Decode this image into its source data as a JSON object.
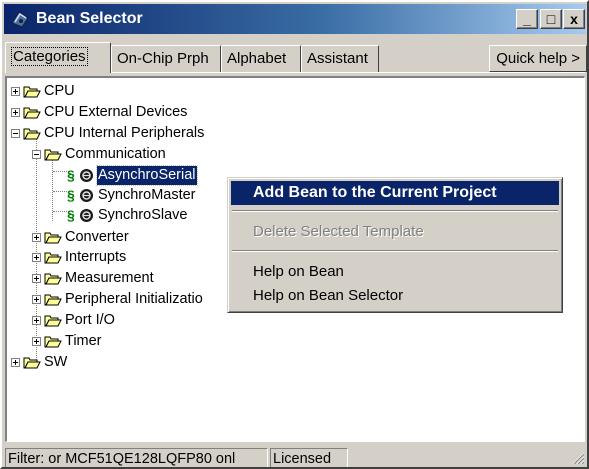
{
  "window": {
    "title": "Bean Selector",
    "buttons": {
      "minimize": "_",
      "maximize": "□",
      "close": "x"
    }
  },
  "tabs": [
    {
      "label": "Categories",
      "active": true
    },
    {
      "label": "On-Chip Prph",
      "active": false
    },
    {
      "label": "Alphabet",
      "active": false
    },
    {
      "label": "Assistant",
      "active": false
    }
  ],
  "quick_help": "Quick help >",
  "tree": {
    "cpu": "CPU",
    "cpu_external": "CPU External Devices",
    "cpu_internal": "CPU Internal Peripherals",
    "communication": "Communication",
    "asynchro_serial": "AsynchroSerial",
    "synchro_master": "SynchroMaster",
    "synchro_slave": "SynchroSlave",
    "bean_marker": "§",
    "converter": "Converter",
    "interrupts": "Interrupts",
    "measurement": "Measurement",
    "peripheral_init": "Peripheral Initializatio",
    "port_io": "Port I/O",
    "timer": "Timer",
    "sw": "SW"
  },
  "context_menu": {
    "add_bean": "Add Bean to the Current Project",
    "delete_template": "Delete Selected Template",
    "help_bean": "Help on Bean",
    "help_selector": "Help on Bean Selector"
  },
  "status": {
    "filter": "Filter: or MCF51QE128LQFP80 onl",
    "license": "Licensed"
  },
  "colors": {
    "selection": "#0a246a",
    "folder": "#ffff99",
    "bean_marker": "#008000"
  }
}
